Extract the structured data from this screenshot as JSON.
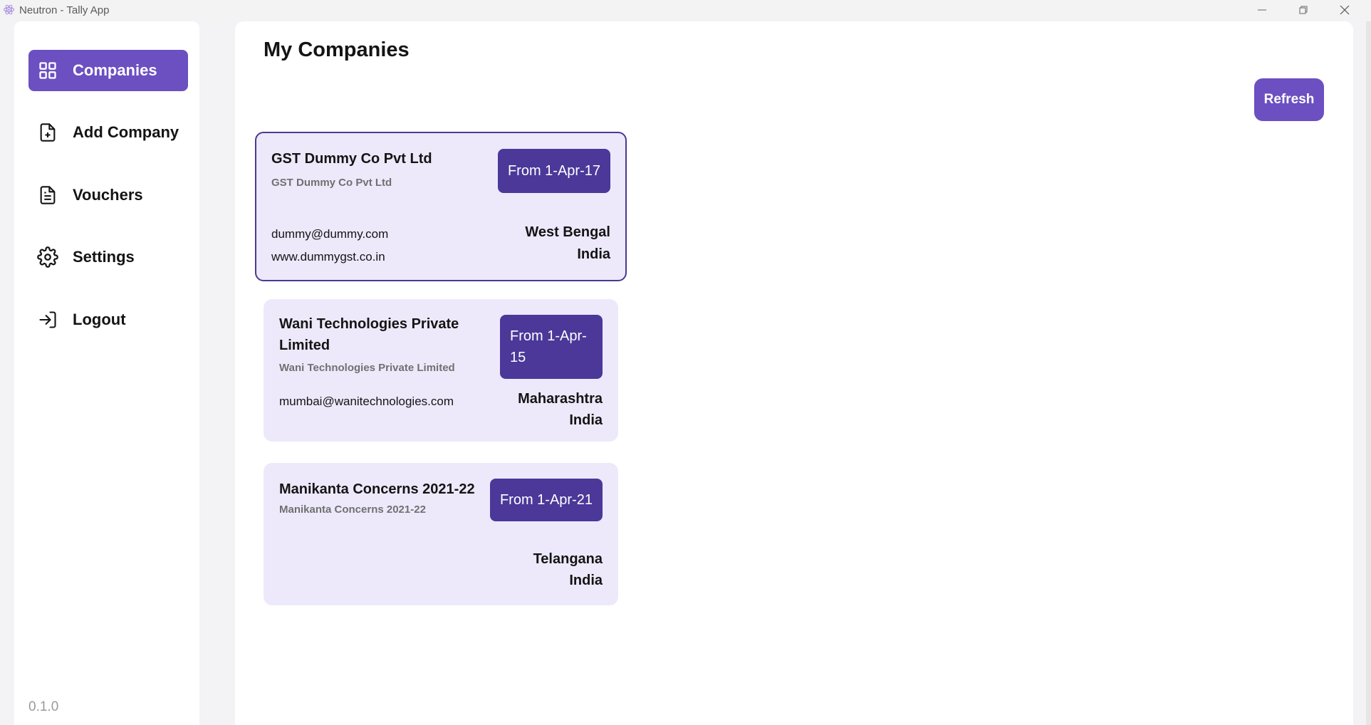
{
  "window": {
    "title": "Neutron - Tally App",
    "icons": [
      "react-icon",
      "minimize-icon",
      "maximize-icon",
      "close-icon"
    ]
  },
  "sidebar": {
    "items": [
      {
        "label": "Companies",
        "icon": "grid-icon",
        "active": true
      },
      {
        "label": "Add Company",
        "icon": "file-plus-icon",
        "active": false
      },
      {
        "label": "Vouchers",
        "icon": "file-text-icon",
        "active": false
      },
      {
        "label": "Settings",
        "icon": "gear-icon",
        "active": false
      },
      {
        "label": "Logout",
        "icon": "logout-icon",
        "active": false
      }
    ],
    "version": "0.1.0"
  },
  "main": {
    "title": "My Companies",
    "refresh_label": "Refresh",
    "companies": [
      {
        "name": "GST Dummy Co Pvt Ltd",
        "sub": "GST Dummy Co Pvt Ltd",
        "from": "From 1-Apr-17",
        "email": "dummy@dummy.com",
        "website": "www.dummygst.co.in",
        "state": "West Bengal",
        "country": "India",
        "selected": true
      },
      {
        "name": "Wani Technologies Private Limited",
        "sub": "Wani Technologies Private Limited",
        "from": "From 1-Apr-15",
        "email": "mumbai@wanitechnologies.com",
        "state": "Maharashtra",
        "country": "India",
        "selected": false
      },
      {
        "name": "Manikanta Concerns 2021-22",
        "sub": "Manikanta Concerns 2021-22",
        "from": "From 1-Apr-21",
        "state": "Telangana",
        "country": "India",
        "selected": false
      }
    ]
  },
  "colors": {
    "accent": "#6c4fc1",
    "badge": "#4b3899",
    "card_bg": "#ede9fb",
    "selected_border": "#4b3890"
  }
}
